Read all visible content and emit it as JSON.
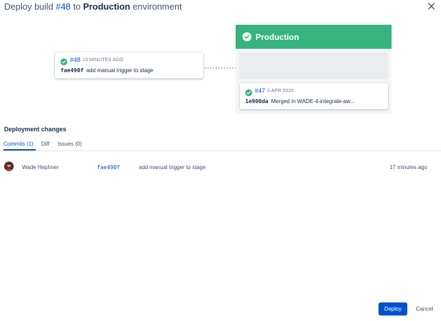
{
  "header": {
    "title_prefix": "Deploy build ",
    "build_ref": "#48",
    "title_mid": " to ",
    "environment": "Production",
    "title_suffix": " environment"
  },
  "source_build": {
    "build_ref": "#48",
    "time_ago": "13 MINUTES AGO",
    "commit_hash": "fae490f",
    "commit_message": "add manual trigger to stage"
  },
  "environment_panel": {
    "name": "Production",
    "color": "#36b37e",
    "previous": {
      "build_ref": "#47",
      "date": "2 APR 2020",
      "commit_hash": "1e900da",
      "commit_message": "Merged in WADE-4-integrate-aw..."
    }
  },
  "changes": {
    "title": "Deployment changes",
    "tabs": [
      {
        "label": "Commits (1)",
        "active": true
      },
      {
        "label": "Diff",
        "active": false
      },
      {
        "label": "Issues (0)",
        "active": false
      }
    ],
    "commits": [
      {
        "author": "Wade Hephner",
        "hash": "fae490f",
        "message": "add manual trigger to stage",
        "time": "17 minutes ago"
      }
    ]
  },
  "footer": {
    "deploy_label": "Deploy",
    "cancel_label": "Cancel"
  },
  "colors": {
    "accent": "#0052cc",
    "success": "#36b37e"
  },
  "icons": [
    "close-icon",
    "check-circle-icon",
    "avatar"
  ]
}
